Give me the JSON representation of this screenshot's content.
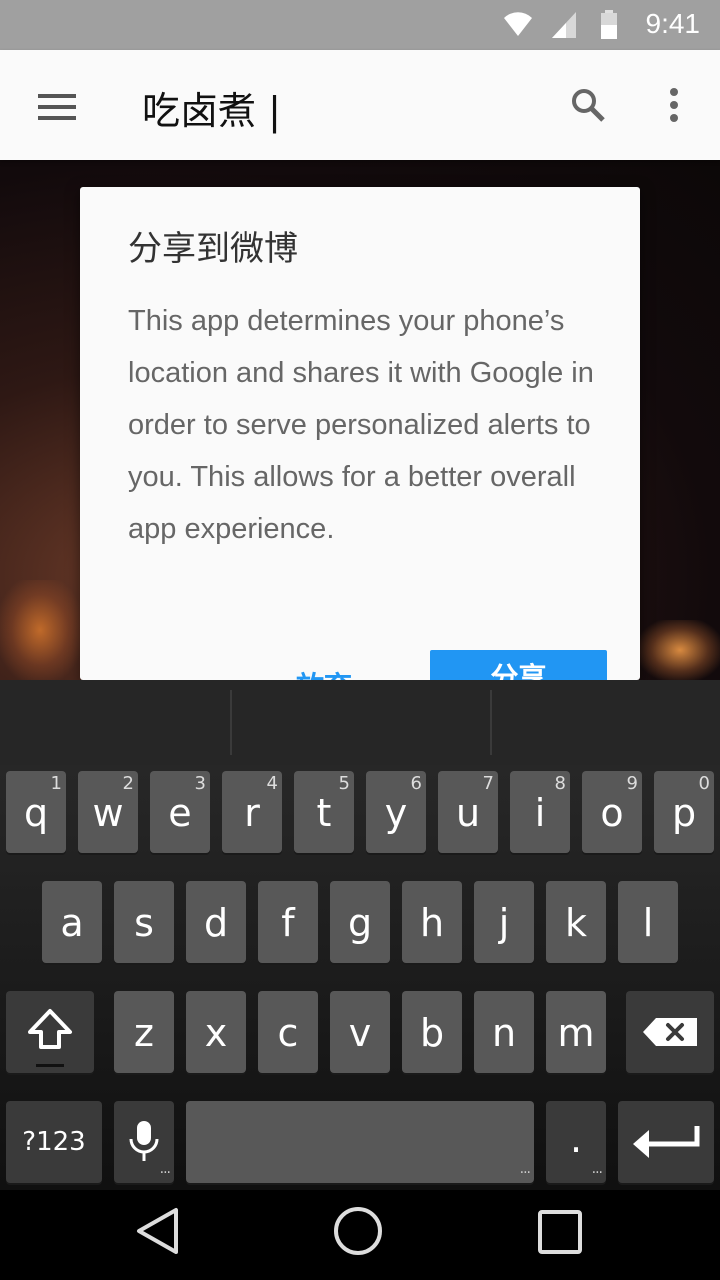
{
  "status_bar": {
    "time": "9:41",
    "icons": [
      "wifi-icon",
      "cellular-signal-icon",
      "battery-icon"
    ]
  },
  "app_bar": {
    "title": "吃卤煮 |",
    "icons": [
      "menu-icon",
      "search-icon",
      "more-vert-icon"
    ]
  },
  "dialog": {
    "title": "分享到微博",
    "message": "This app determines your phone’s location and shares it with Google in order to serve personalized alerts to you. This allows for a better overall app experience.",
    "cancel_label": "放弃",
    "confirm_label": "分享"
  },
  "keyboard": {
    "row1": [
      {
        "k": "q",
        "h": "1"
      },
      {
        "k": "w",
        "h": "2"
      },
      {
        "k": "e",
        "h": "3"
      },
      {
        "k": "r",
        "h": "4"
      },
      {
        "k": "t",
        "h": "5"
      },
      {
        "k": "y",
        "h": "6"
      },
      {
        "k": "u",
        "h": "7"
      },
      {
        "k": "i",
        "h": "8"
      },
      {
        "k": "o",
        "h": "9"
      },
      {
        "k": "p",
        "h": "0"
      }
    ],
    "row2": [
      "a",
      "s",
      "d",
      "f",
      "g",
      "h",
      "j",
      "k",
      "l"
    ],
    "row3": [
      "z",
      "x",
      "c",
      "v",
      "b",
      "n",
      "m"
    ],
    "symbols_label": "?123",
    "period_label": ".",
    "icons": [
      "shift-icon",
      "backspace-icon",
      "microphone-icon",
      "enter-icon"
    ]
  },
  "nav_bar": {
    "icons": [
      "back-icon",
      "home-icon",
      "recents-icon"
    ]
  },
  "colors": {
    "accent": "#2196f3",
    "status_bar": "#a0a0a0",
    "app_bar": "#fafafa",
    "key": "#585858"
  }
}
